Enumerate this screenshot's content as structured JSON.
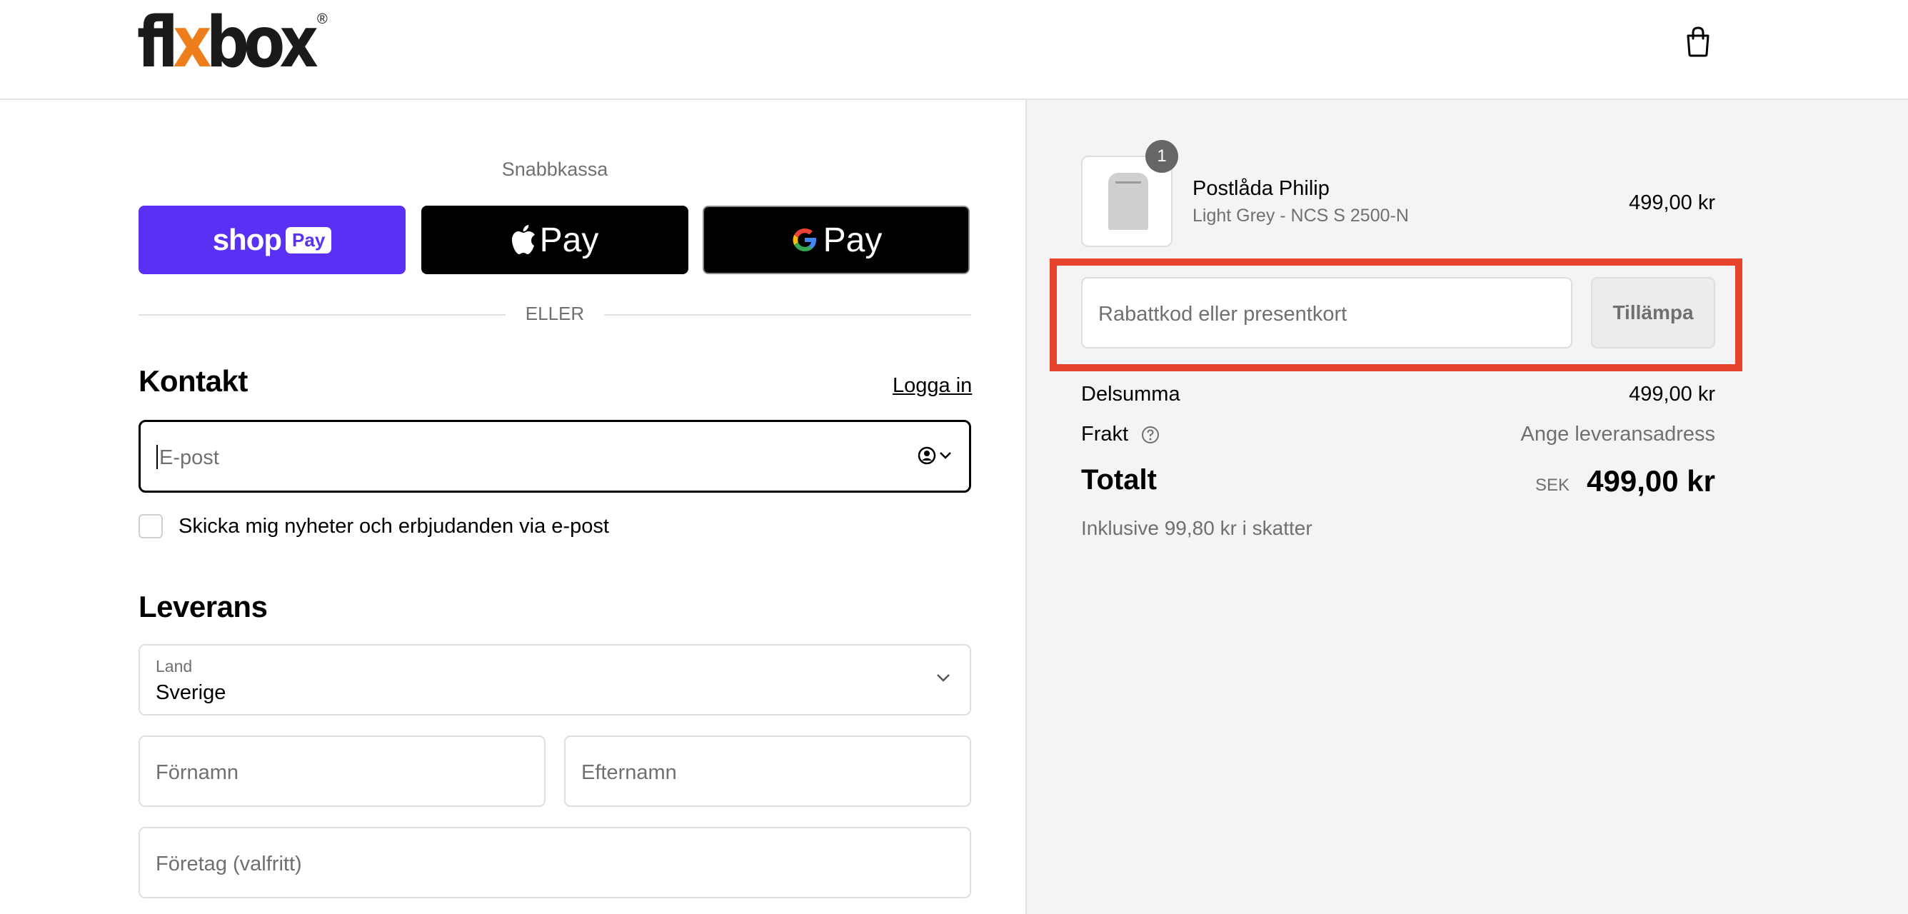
{
  "brand": {
    "logo_parts": [
      "fl",
      "x",
      "box"
    ],
    "registered_mark": "®",
    "accent_color": "#ee7d1c"
  },
  "header": {
    "cart_icon": "shopping-bag-icon"
  },
  "express_checkout": {
    "title": "Snabbkassa",
    "shop_pay": {
      "word": "shop",
      "pill": "Pay",
      "color": "#5a31f4"
    },
    "apple_pay": {
      "word": "Pay",
      "icon": "apple-logo-icon"
    },
    "google_pay": {
      "word": "Pay",
      "icon": "google-g-icon"
    },
    "divider": "ELLER"
  },
  "contact": {
    "title": "Kontakt",
    "login_link": "Logga in",
    "email_placeholder": "E-post",
    "newsletter_label": "Skicka mig nyheter och erbjudanden via e-post",
    "newsletter_checked": false
  },
  "delivery": {
    "title": "Leverans",
    "country_label": "Land",
    "country_value": "Sverige",
    "first_name_placeholder": "Förnamn",
    "last_name_placeholder": "Efternamn",
    "company_placeholder": "Företag (valfritt)"
  },
  "order_summary": {
    "product": {
      "name": "Postlåda Philip",
      "variant": "Light Grey - NCS S 2500-N",
      "price": "499,00 kr",
      "quantity": "1"
    },
    "discount_placeholder": "Rabattkod eller presentkort",
    "apply_label": "Tillämpa",
    "subtotal_label": "Delsumma",
    "subtotal_value": "499,00 kr",
    "shipping_label": "Frakt",
    "shipping_value": "Ange leveransadress",
    "total_label": "Totalt",
    "currency": "SEK",
    "total_value": "499,00 kr",
    "taxes_note": "Inklusive 99,80 kr i skatter",
    "highlight_color": "#e8432c"
  }
}
